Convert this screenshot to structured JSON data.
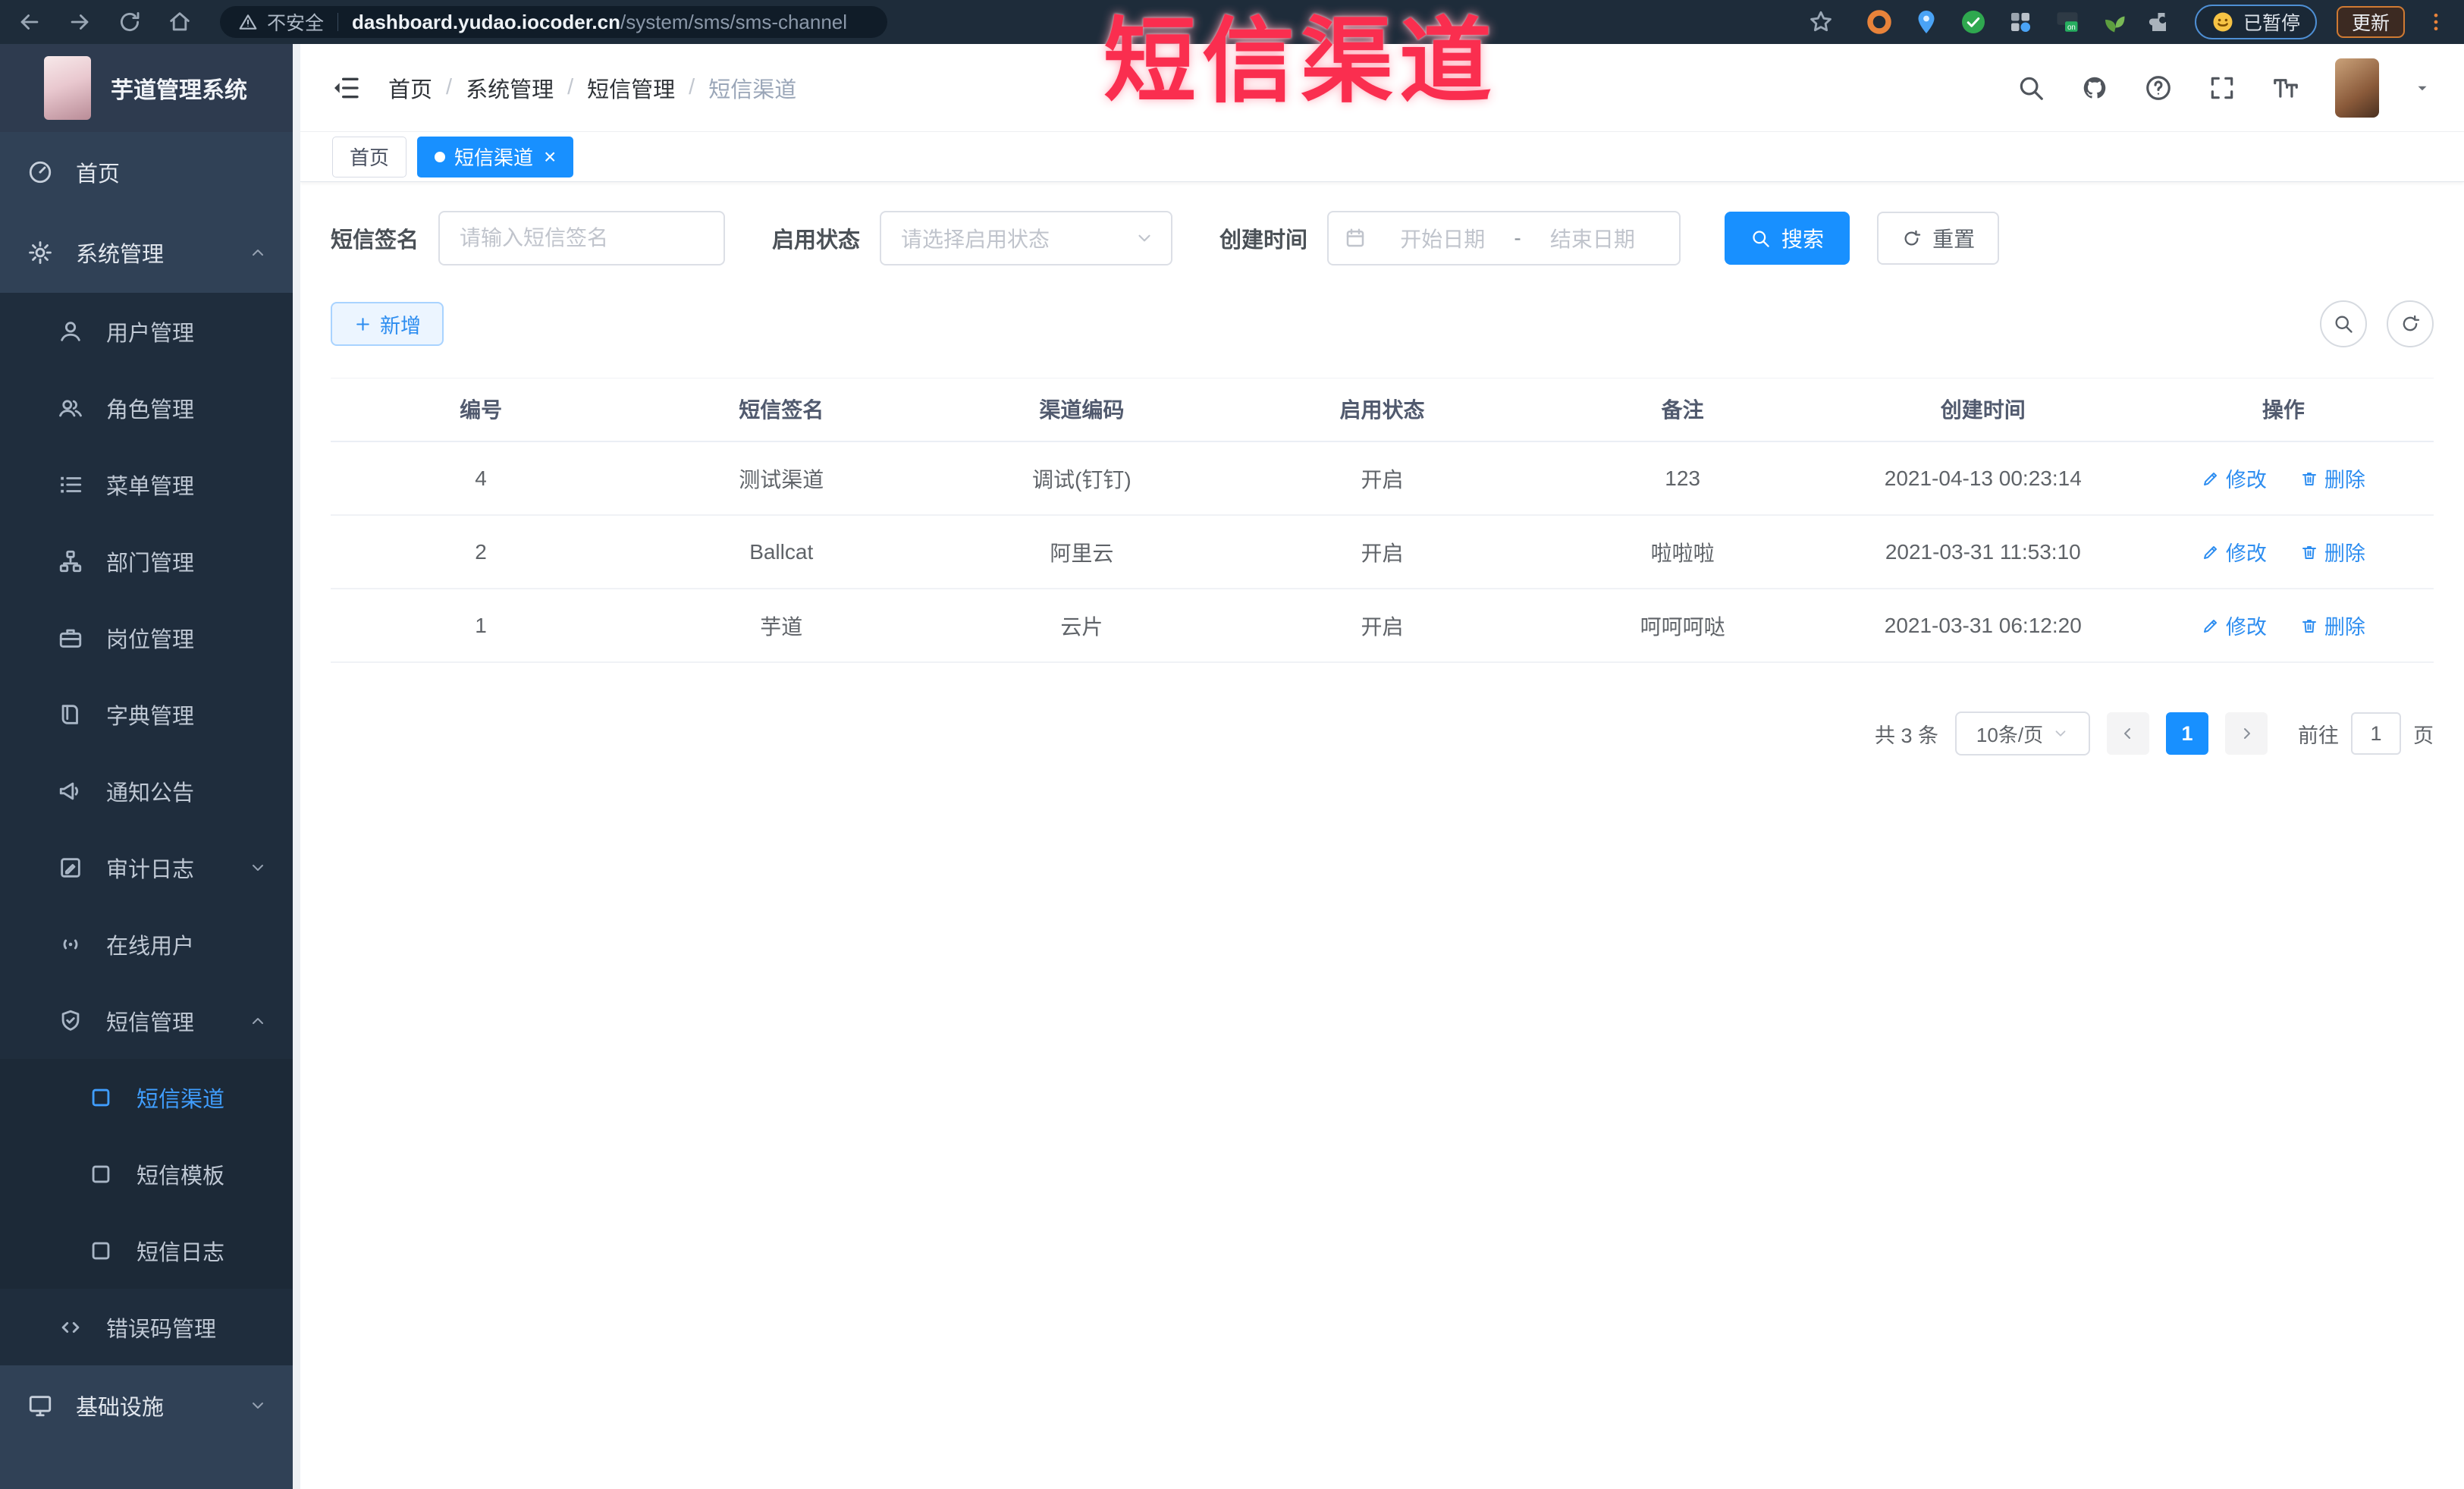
{
  "browser": {
    "security_label": "不安全",
    "url_host": "dashboard.yudao.iocoder.cn",
    "url_path": "/system/sms/sms-channel",
    "extensions": [
      "ext-orange-ring",
      "ext-blue-pin",
      "ext-green-check",
      "ext-grid",
      "ext-onoff",
      "ext-leaf",
      "ext-puzzle"
    ],
    "paused_label": "已暂停",
    "update_label": "更新"
  },
  "overlay_title": "短信渠道",
  "sidebar": {
    "logo_title": "芋道管理系统",
    "items": [
      {
        "name": "home",
        "label": "首页",
        "icon": "dashboard",
        "level": 1
      },
      {
        "name": "system",
        "label": "系统管理",
        "icon": "gear",
        "level": 1,
        "chevron": "up"
      },
      {
        "name": "user-mgmt",
        "label": "用户管理",
        "icon": "user",
        "level": 2
      },
      {
        "name": "role-mgmt",
        "label": "角色管理",
        "icon": "users",
        "level": 2
      },
      {
        "name": "menu-mgmt",
        "label": "菜单管理",
        "icon": "list",
        "level": 2
      },
      {
        "name": "dept-mgmt",
        "label": "部门管理",
        "icon": "tree",
        "level": 2
      },
      {
        "name": "post-mgmt",
        "label": "岗位管理",
        "icon": "briefcase",
        "level": 2
      },
      {
        "name": "dict-mgmt",
        "label": "字典管理",
        "icon": "book",
        "level": 2
      },
      {
        "name": "notice",
        "label": "通知公告",
        "icon": "megaphone",
        "level": 2
      },
      {
        "name": "audit-log",
        "label": "审计日志",
        "icon": "log",
        "level": 2,
        "chevron": "down"
      },
      {
        "name": "online-users",
        "label": "在线用户",
        "icon": "online",
        "level": 2
      },
      {
        "name": "sms-mgmt",
        "label": "短信管理",
        "icon": "shield",
        "level": 2,
        "chevron": "up"
      },
      {
        "name": "sms-channel",
        "label": "短信渠道",
        "icon": "square",
        "level": 3,
        "active": true
      },
      {
        "name": "sms-template",
        "label": "短信模板",
        "icon": "square",
        "level": 3
      },
      {
        "name": "sms-log",
        "label": "短信日志",
        "icon": "square",
        "level": 3
      },
      {
        "name": "error-code",
        "label": "错误码管理",
        "icon": "code",
        "level": 2
      },
      {
        "name": "infra",
        "label": "基础设施",
        "icon": "monitor",
        "level": 1,
        "chevron": "down"
      }
    ]
  },
  "header": {
    "breadcrumbs": [
      "首页",
      "系统管理",
      "短信管理",
      "短信渠道"
    ]
  },
  "tabs": [
    {
      "label": "首页",
      "active": false,
      "closable": false
    },
    {
      "label": "短信渠道",
      "active": true,
      "closable": true
    }
  ],
  "filters": {
    "sign_label": "短信签名",
    "sign_placeholder": "请输入短信签名",
    "status_label": "启用状态",
    "status_placeholder": "请选择启用状态",
    "time_label": "创建时间",
    "date_start_placeholder": "开始日期",
    "date_separator": "-",
    "date_end_placeholder": "结束日期",
    "search_label": "搜索",
    "reset_label": "重置"
  },
  "toolbar": {
    "add_label": "新增"
  },
  "table": {
    "columns": [
      "编号",
      "短信签名",
      "渠道编码",
      "启用状态",
      "备注",
      "创建时间",
      "操作"
    ],
    "edit_label": "修改",
    "delete_label": "删除",
    "rows": [
      {
        "id": "4",
        "sign": "测试渠道",
        "code": "调试(钉钉)",
        "status": "开启",
        "remark": "123",
        "created": "2021-04-13 00:23:14"
      },
      {
        "id": "2",
        "sign": "Ballcat",
        "code": "阿里云",
        "status": "开启",
        "remark": "啦啦啦",
        "created": "2021-03-31 11:53:10"
      },
      {
        "id": "1",
        "sign": "芋道",
        "code": "云片",
        "status": "开启",
        "remark": "呵呵呵哒",
        "created": "2021-03-31 06:12:20"
      }
    ]
  },
  "pagination": {
    "total_label": "共 3 条",
    "page_size_label": "10条/页",
    "current_page": "1",
    "goto_label": "前往",
    "goto_value": "1",
    "page_unit_label": "页"
  },
  "colors": {
    "primary": "#1890ff",
    "sidebar_bg": "#304156",
    "submenu_bg": "#1f2d3d",
    "overlay_red": "#fa2e4f"
  }
}
